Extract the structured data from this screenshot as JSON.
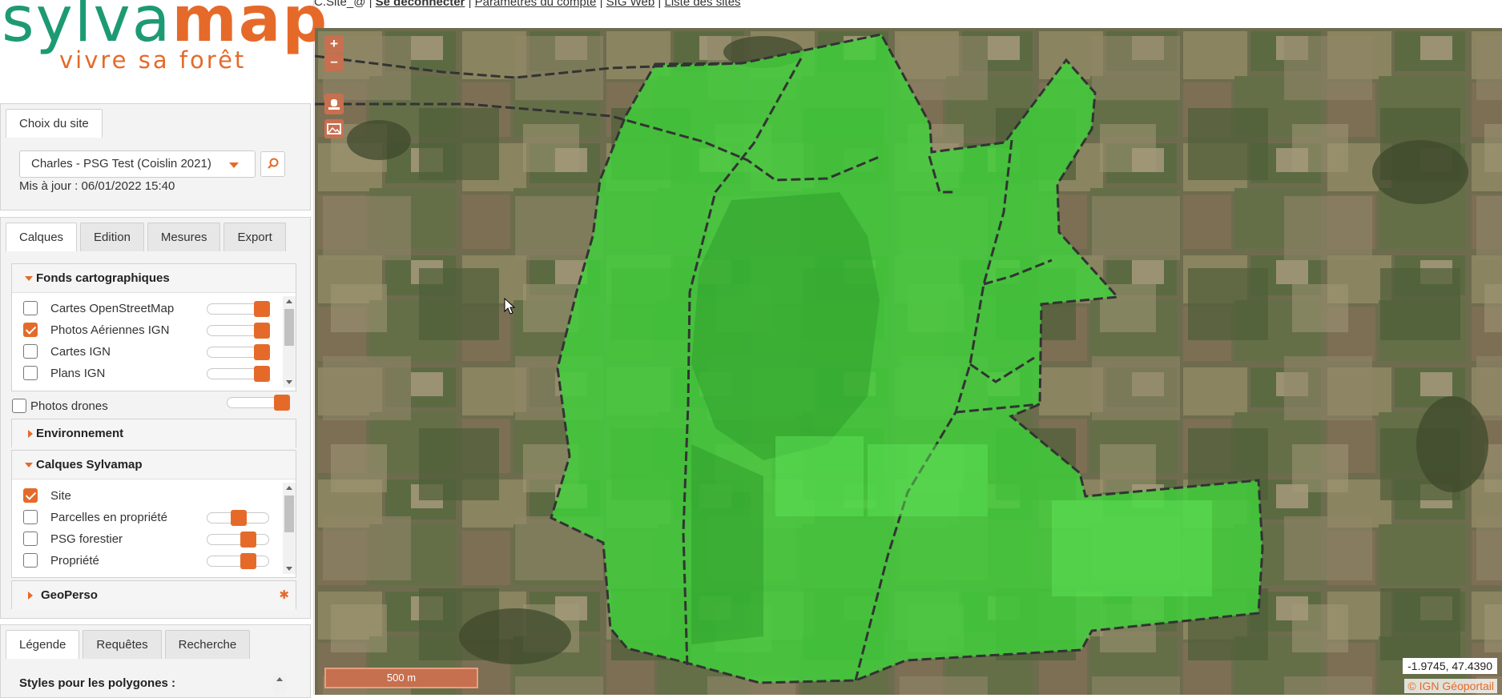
{
  "topbar": {
    "user": "C.Site_@",
    "logout": "Se déconnecter",
    "account": "Paramètres du compte",
    "sigweb": "SIG Web",
    "sites": "Liste des sites",
    "sep": "|"
  },
  "logo": {
    "part1": "sylva",
    "part2": "map",
    "tagline": "vivre sa forêt"
  },
  "site_panel": {
    "tab": "Choix du site",
    "selected_site": "Charles - PSG Test (Coislin 2021)",
    "updated": "Mis à jour : 06/01/2022 15:40"
  },
  "layer_tabs": [
    "Calques",
    "Edition",
    "Mesures",
    "Export"
  ],
  "fonds": {
    "title": "Fonds cartographiques",
    "items": [
      {
        "label": "Cartes OpenStreetMap",
        "checked": false,
        "opacity": 1.0
      },
      {
        "label": "Photos Aériennes IGN",
        "checked": true,
        "opacity": 1.0
      },
      {
        "label": "Cartes IGN",
        "checked": false,
        "opacity": 1.0
      },
      {
        "label": "Plans IGN",
        "checked": false,
        "opacity": 1.0
      }
    ]
  },
  "drones": {
    "label": "Photos drones",
    "checked": false,
    "opacity": 1.0
  },
  "environnement": {
    "title": "Environnement"
  },
  "calques_sylvamap": {
    "title": "Calques Sylvamap",
    "items": [
      {
        "label": "Site",
        "checked": true
      },
      {
        "label": "Parcelles en propriété",
        "checked": false,
        "opacity": 0.5
      },
      {
        "label": "PSG forestier",
        "checked": false,
        "opacity": 0.7
      },
      {
        "label": "Propriété",
        "checked": false,
        "opacity": 0.7
      }
    ]
  },
  "geoperso": {
    "title": "GeoPerso"
  },
  "bottom_tabs": [
    "Légende",
    "Requêtes",
    "Recherche"
  ],
  "legend": {
    "title": "Styles pour les polygones :"
  },
  "map": {
    "zoom_in": "+",
    "zoom_out": "–",
    "scale": "500 m",
    "coords": "-1.9745, 47.4390",
    "attribution": "© IGN Géoportail"
  },
  "colors": {
    "accent": "#e56a2a",
    "logo_green": "#1d9a73",
    "polygon_fill": "#3fd23a"
  }
}
